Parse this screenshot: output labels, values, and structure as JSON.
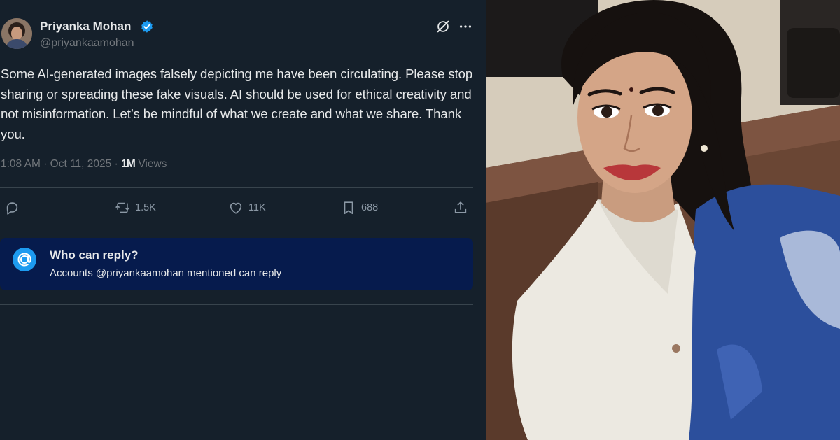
{
  "tweet": {
    "display_name": "Priyanka Mohan",
    "handle": "@priyankaamohan",
    "verified": true,
    "text": "Some AI-generated images falsely depicting me have been circulating. Please stop sharing or spreading these fake visuals. AI should be used for ethical creativity and not misinformation. Let’s be mindful of what we create and what we share. Thank you.",
    "time": "1:08 AM",
    "date": "Oct 11, 2025",
    "separator": "·",
    "views_count": "1M",
    "views_label": "Views"
  },
  "actions": {
    "reposts": "1.5K",
    "likes": "11K",
    "bookmarks": "688"
  },
  "reply_settings": {
    "title": "Who can reply?",
    "subtitle": "Accounts @priyankaamohan mentioned can reply"
  },
  "icons": {
    "avatar": "profile-avatar",
    "verified": "verified-badge-icon",
    "grok": "grok-icon",
    "more": "more-icon",
    "reply": "reply-icon",
    "repost": "repost-icon",
    "like": "heart-icon",
    "bookmark": "bookmark-icon",
    "share": "share-icon",
    "mention": "at-sign-icon"
  },
  "colors": {
    "background": "#15202b",
    "text": "#e7e9ea",
    "muted": "#71767b",
    "accent": "#1d9bf0",
    "reply_box": "#061b4d"
  }
}
